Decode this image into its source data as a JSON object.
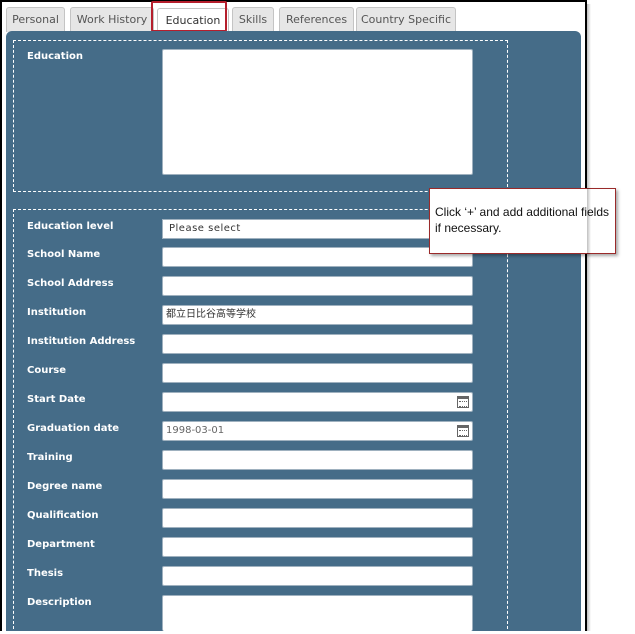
{
  "tabs": [
    {
      "label": "Personal",
      "active": false
    },
    {
      "label": "Work History",
      "active": false
    },
    {
      "label": "Education",
      "active": true
    },
    {
      "label": "Skills",
      "active": false
    },
    {
      "label": "References",
      "active": false
    },
    {
      "label": "Country Specific",
      "active": false
    }
  ],
  "education_section": {
    "label": "Education",
    "value": ""
  },
  "details": {
    "education_level": {
      "label": "Education level",
      "selected": "Please select"
    },
    "school_name": {
      "label": "School Name",
      "value": ""
    },
    "school_address": {
      "label": "School Address",
      "value": ""
    },
    "institution": {
      "label": "Institution",
      "value": "都立日比谷高等学校"
    },
    "institution_address": {
      "label": "Institution Address",
      "value": ""
    },
    "course": {
      "label": "Course",
      "value": ""
    },
    "start_date": {
      "label": "Start Date",
      "value": ""
    },
    "graduation_date": {
      "label": "Graduation date",
      "value": "1998-03-01"
    },
    "training": {
      "label": "Training",
      "value": ""
    },
    "degree_name": {
      "label": "Degree name",
      "value": ""
    },
    "qualification": {
      "label": "Qualification",
      "value": ""
    },
    "department": {
      "label": "Department",
      "value": ""
    },
    "thesis": {
      "label": "Thesis",
      "value": ""
    },
    "description": {
      "label": "Description",
      "value": ""
    }
  },
  "tooltip": {
    "text": "Click ‘+’ and add additional fields if necessary."
  },
  "colors": {
    "panel": "#456c88",
    "highlight": "#b51e2c"
  }
}
